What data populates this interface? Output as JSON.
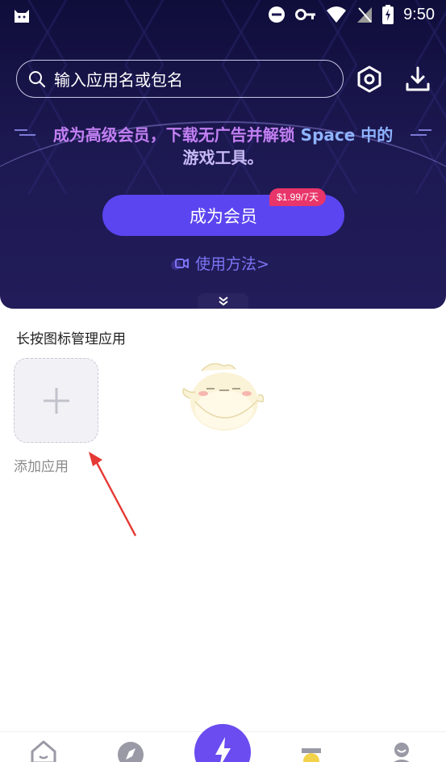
{
  "status_bar": {
    "time": "9:50"
  },
  "search": {
    "placeholder": "输入应用名或包名"
  },
  "promo": {
    "line1_a": "成为高级会员，下载无广告并解锁 ",
    "line1_em": "Space 中的",
    "line2": "游戏工具。"
  },
  "vip": {
    "button_label": "成为会员",
    "price_badge": "$1.99/7天"
  },
  "howto": {
    "label": "使用方法>"
  },
  "apps": {
    "section_title": "长按图标管理应用",
    "add_label": "添加应用"
  },
  "colors": {
    "accent": "#5b45f0",
    "badge": "#e8356a",
    "hero_bg": "#1c1850",
    "link": "#7d74f5",
    "arrow": "#e53935"
  },
  "bottom_nav": {
    "items": [
      "home-icon",
      "compass-icon",
      "boost-icon",
      "gift-icon",
      "profile-icon"
    ]
  }
}
